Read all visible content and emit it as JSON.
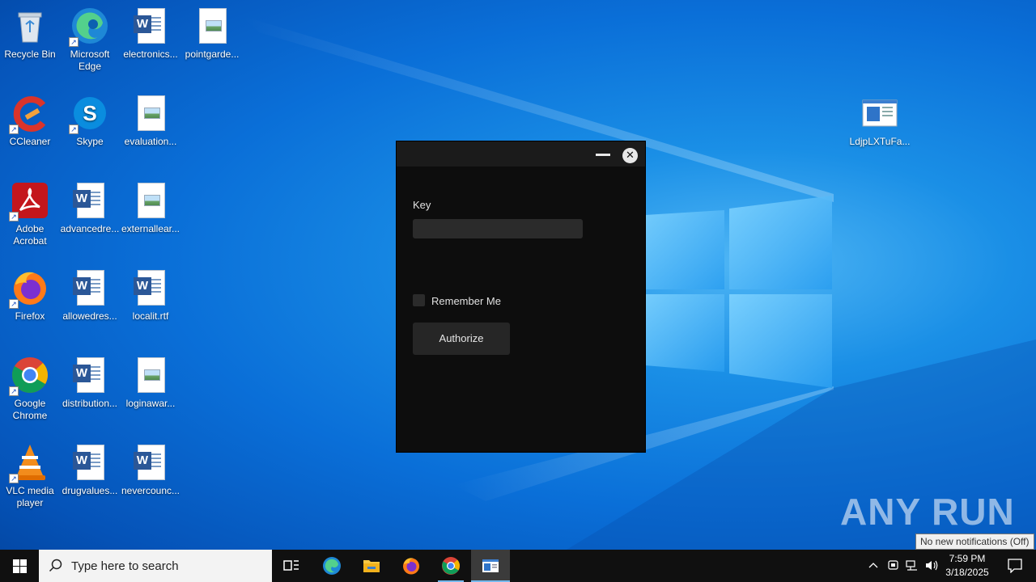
{
  "desktop": {
    "icons": [
      {
        "label": "Recycle Bin"
      },
      {
        "label": "Microsoft Edge"
      },
      {
        "label": "electronics..."
      },
      {
        "label": "pointgarde..."
      },
      {
        "label": "CCleaner"
      },
      {
        "label": "Skype"
      },
      {
        "label": "evaluation..."
      },
      {
        "label": "Adobe Acrobat"
      },
      {
        "label": "advancedre..."
      },
      {
        "label": "externallear..."
      },
      {
        "label": "Firefox"
      },
      {
        "label": "allowedres..."
      },
      {
        "label": "localit.rtf"
      },
      {
        "label": "Google Chrome"
      },
      {
        "label": "distribution..."
      },
      {
        "label": "loginawar..."
      },
      {
        "label": "VLC media player"
      },
      {
        "label": "drugvalues..."
      },
      {
        "label": "nevercounc..."
      },
      {
        "label": "LdjpLXTuFa..."
      }
    ]
  },
  "dialog": {
    "minimize_icon": "minimize-icon",
    "close_glyph": "✕",
    "key_label": "Key",
    "key_value": "",
    "remember_label": "Remember Me",
    "remember_checked": false,
    "authorize_label": "Authorize"
  },
  "watermark": {
    "text": "ANY RUN"
  },
  "tooltip": {
    "text": "No new notifications (Off)"
  },
  "taskbar": {
    "search_placeholder": "Type here to search",
    "pinned": [
      "task-view-icon",
      "edge-icon",
      "file-explorer-icon",
      "firefox-icon",
      "chrome-icon",
      "app-window-icon"
    ],
    "clock_time": "7:59 PM",
    "clock_date": "3/18/2025"
  },
  "colors": {
    "desktop_blue": "#0a6fd8",
    "dialog_bg": "#0d0d0d",
    "taskbar_bg": "#101010",
    "accent": "#76b9ed"
  }
}
